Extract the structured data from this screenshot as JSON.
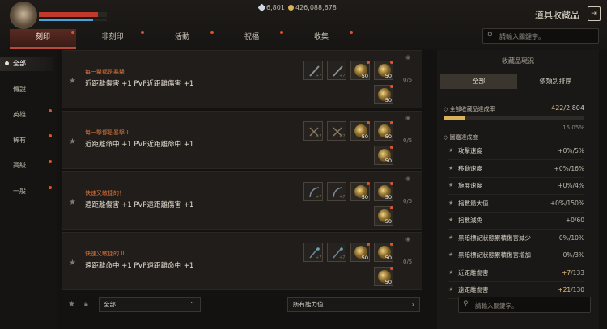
{
  "header": {
    "currency_1": "6,801",
    "currency_2": "426,088,678",
    "page_title": "道具收藏品",
    "hp_pct": 87,
    "mp_pct": 80,
    "colors": {
      "accent": "#b84a3a",
      "notify": "#d9552f",
      "gold": "#e0c27a"
    }
  },
  "tabs": [
    {
      "label": "刻印",
      "active": true
    },
    {
      "label": "非刻印",
      "active": false
    },
    {
      "label": "活動",
      "active": false
    },
    {
      "label": "祝福",
      "active": false
    },
    {
      "label": "收集",
      "active": false
    }
  ],
  "search": {
    "placeholder": "請輸入關鍵字。"
  },
  "sidebar": {
    "items": [
      {
        "label": "全部",
        "active": true
      },
      {
        "label": "傳說"
      },
      {
        "label": "英雄"
      },
      {
        "label": "稀有"
      },
      {
        "label": "高級"
      },
      {
        "label": "一般"
      }
    ]
  },
  "collections": [
    {
      "sub": "每一擊都是暴擊",
      "main": "近距離傷害 +1 PVP近距離傷害 +1",
      "progress": "0/5",
      "items": [
        {
          "type": "sword",
          "lvl": "+7"
        },
        {
          "type": "sword",
          "lvl": "+7"
        },
        {
          "type": "orb",
          "count": "50"
        },
        {
          "type": "orb",
          "count": "50"
        },
        {
          "type": "orb",
          "count": "50"
        }
      ]
    },
    {
      "sub": "每一擊都是暴擊 II",
      "main": "近距離命中 +1 PVP近距離命中 +1",
      "progress": "0/5",
      "items": [
        {
          "type": "axe",
          "lvl": "+7"
        },
        {
          "type": "axe",
          "lvl": "+7"
        },
        {
          "type": "orb",
          "count": "50"
        },
        {
          "type": "orb",
          "count": "50"
        },
        {
          "type": "orb",
          "count": "50"
        }
      ]
    },
    {
      "sub": "快速又敏捷的！",
      "main": "遠距離傷害 +1 PVP遠距離傷害 +1",
      "progress": "0/5",
      "items": [
        {
          "type": "bow",
          "lvl": "+7"
        },
        {
          "type": "bow",
          "lvl": "+7"
        },
        {
          "type": "orb",
          "count": "50"
        },
        {
          "type": "orb",
          "count": "50"
        },
        {
          "type": "orb",
          "count": "50"
        }
      ]
    },
    {
      "sub": "快速又敏捷的 II",
      "main": "遠距離命中 +1 PVP遠距離命中 +1",
      "progress": "0/5",
      "items": [
        {
          "type": "staff",
          "lvl": "+7"
        },
        {
          "type": "staff",
          "lvl": "+7"
        },
        {
          "type": "orb",
          "count": "50"
        },
        {
          "type": "orb",
          "count": "50"
        },
        {
          "type": "orb",
          "count": "50"
        }
      ]
    }
  ],
  "bottom": {
    "category": "全部",
    "ability_filter": "所有能力值"
  },
  "panel": {
    "title": "收藏品現況",
    "tabs": [
      "全部",
      "依類別排序"
    ],
    "rate_label": "全部收藏品達成率",
    "rate_done": "422",
    "rate_total": "/2,804",
    "rate_pct": "15.05%",
    "rate_fraction": 0.1505,
    "section_label": "圖鑑達成度",
    "stats": [
      {
        "name": "攻擊速度",
        "value": "+0%",
        "max": "/5%"
      },
      {
        "name": "移動速度",
        "value": "+0%",
        "max": "/16%"
      },
      {
        "name": "施展速度",
        "value": "+0%",
        "max": "/4%"
      },
      {
        "name": "指數最大值",
        "value": "+0%",
        "max": "/150%"
      },
      {
        "name": "指數減免",
        "value": "+0",
        "max": "/60"
      },
      {
        "name": "黑暗標記狀態累積傷害減少",
        "value": "0%",
        "max": "/10%"
      },
      {
        "name": "黑暗標記狀態累積傷害增加",
        "value": "0%",
        "max": "/3%"
      },
      {
        "name": "近距離傷害",
        "value": "+7",
        "max": "/133",
        "gold": true
      },
      {
        "name": "遠距離傷害",
        "value": "+21",
        "max": "/130",
        "gold": true
      }
    ],
    "search_placeholder": "請輸入關鍵字。"
  }
}
